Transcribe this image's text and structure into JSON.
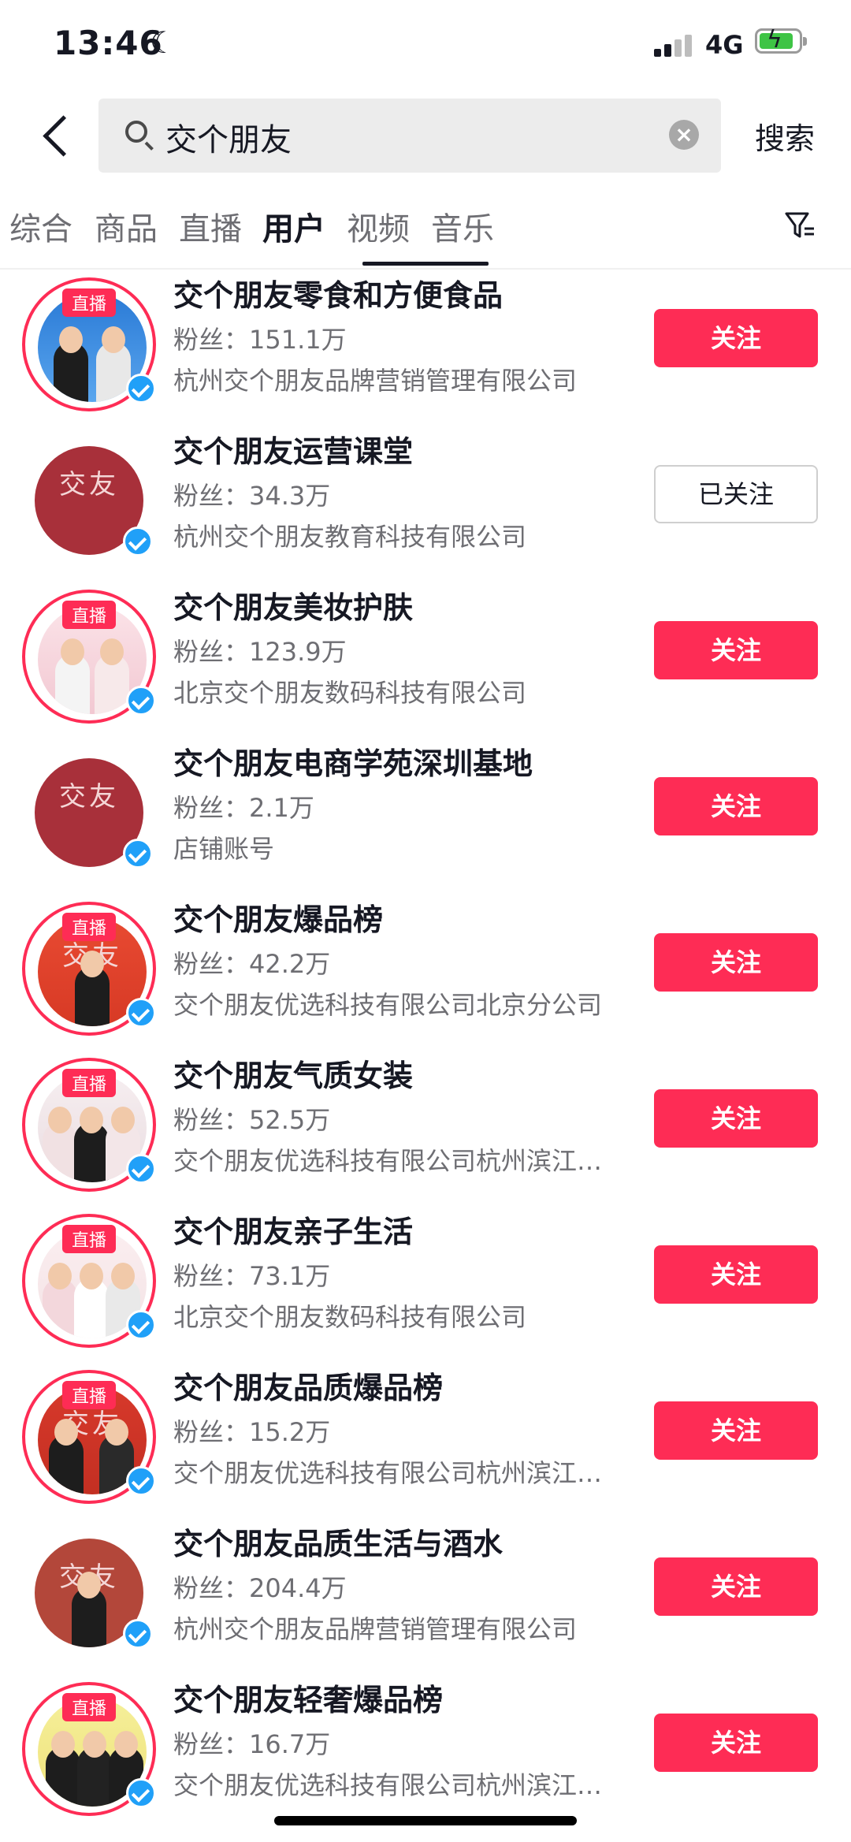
{
  "status_bar": {
    "time": "13:46",
    "network": "4G"
  },
  "search": {
    "query": "交个朋友",
    "button_label": "搜索"
  },
  "tabs": [
    {
      "label": "综合"
    },
    {
      "label": "商品"
    },
    {
      "label": "直播"
    },
    {
      "label": "用户"
    },
    {
      "label": "视频"
    },
    {
      "label": "音乐"
    }
  ],
  "active_tab": "用户",
  "live_label": "直播",
  "users": [
    {
      "name": "交个朋友零食和方便食品",
      "fans": "粉丝：151.1万",
      "company": "杭州交个朋友品牌营销管理有限公司",
      "follow": "关注",
      "live": true
    },
    {
      "name": "交个朋友运营课堂",
      "fans": "粉丝：34.3万",
      "company": "杭州交个朋友教育科技有限公司",
      "follow": "已关注",
      "live": false
    },
    {
      "name": "交个朋友美妆护肤",
      "fans": "粉丝：123.9万",
      "company": "北京交个朋友数码科技有限公司",
      "follow": "关注",
      "live": true
    },
    {
      "name": "交个朋友电商学苑深圳基地",
      "fans": "粉丝：2.1万",
      "company": "店铺账号",
      "follow": "关注",
      "live": false
    },
    {
      "name": "交个朋友爆品榜",
      "fans": "粉丝：42.2万",
      "company": "交个朋友优选科技有限公司北京分公司",
      "follow": "关注",
      "live": true
    },
    {
      "name": "交个朋友气质女装",
      "fans": "粉丝：52.5万",
      "company": "交个朋友优选科技有限公司杭州滨江…",
      "follow": "关注",
      "live": true
    },
    {
      "name": "交个朋友亲子生活",
      "fans": "粉丝：73.1万",
      "company": "北京交个朋友数码科技有限公司",
      "follow": "关注",
      "live": true
    },
    {
      "name": "交个朋友品质爆品榜",
      "fans": "粉丝：15.2万",
      "company": "交个朋友优选科技有限公司杭州滨江…",
      "follow": "关注",
      "live": true
    },
    {
      "name": "交个朋友品质生活与酒水",
      "fans": "粉丝：204.4万",
      "company": "杭州交个朋友品牌营销管理有限公司",
      "follow": "关注",
      "live": false
    },
    {
      "name": "交个朋友轻奢爆品榜",
      "fans": "粉丝：16.7万",
      "company": "交个朋友优选科技有限公司杭州滨江…",
      "follow": "关注",
      "live": true
    }
  ],
  "avatar_logo": "交友",
  "colors": {
    "accent": "#fe2c55",
    "verified": "#20a0f8",
    "brand_maroon": "#a8303a"
  }
}
